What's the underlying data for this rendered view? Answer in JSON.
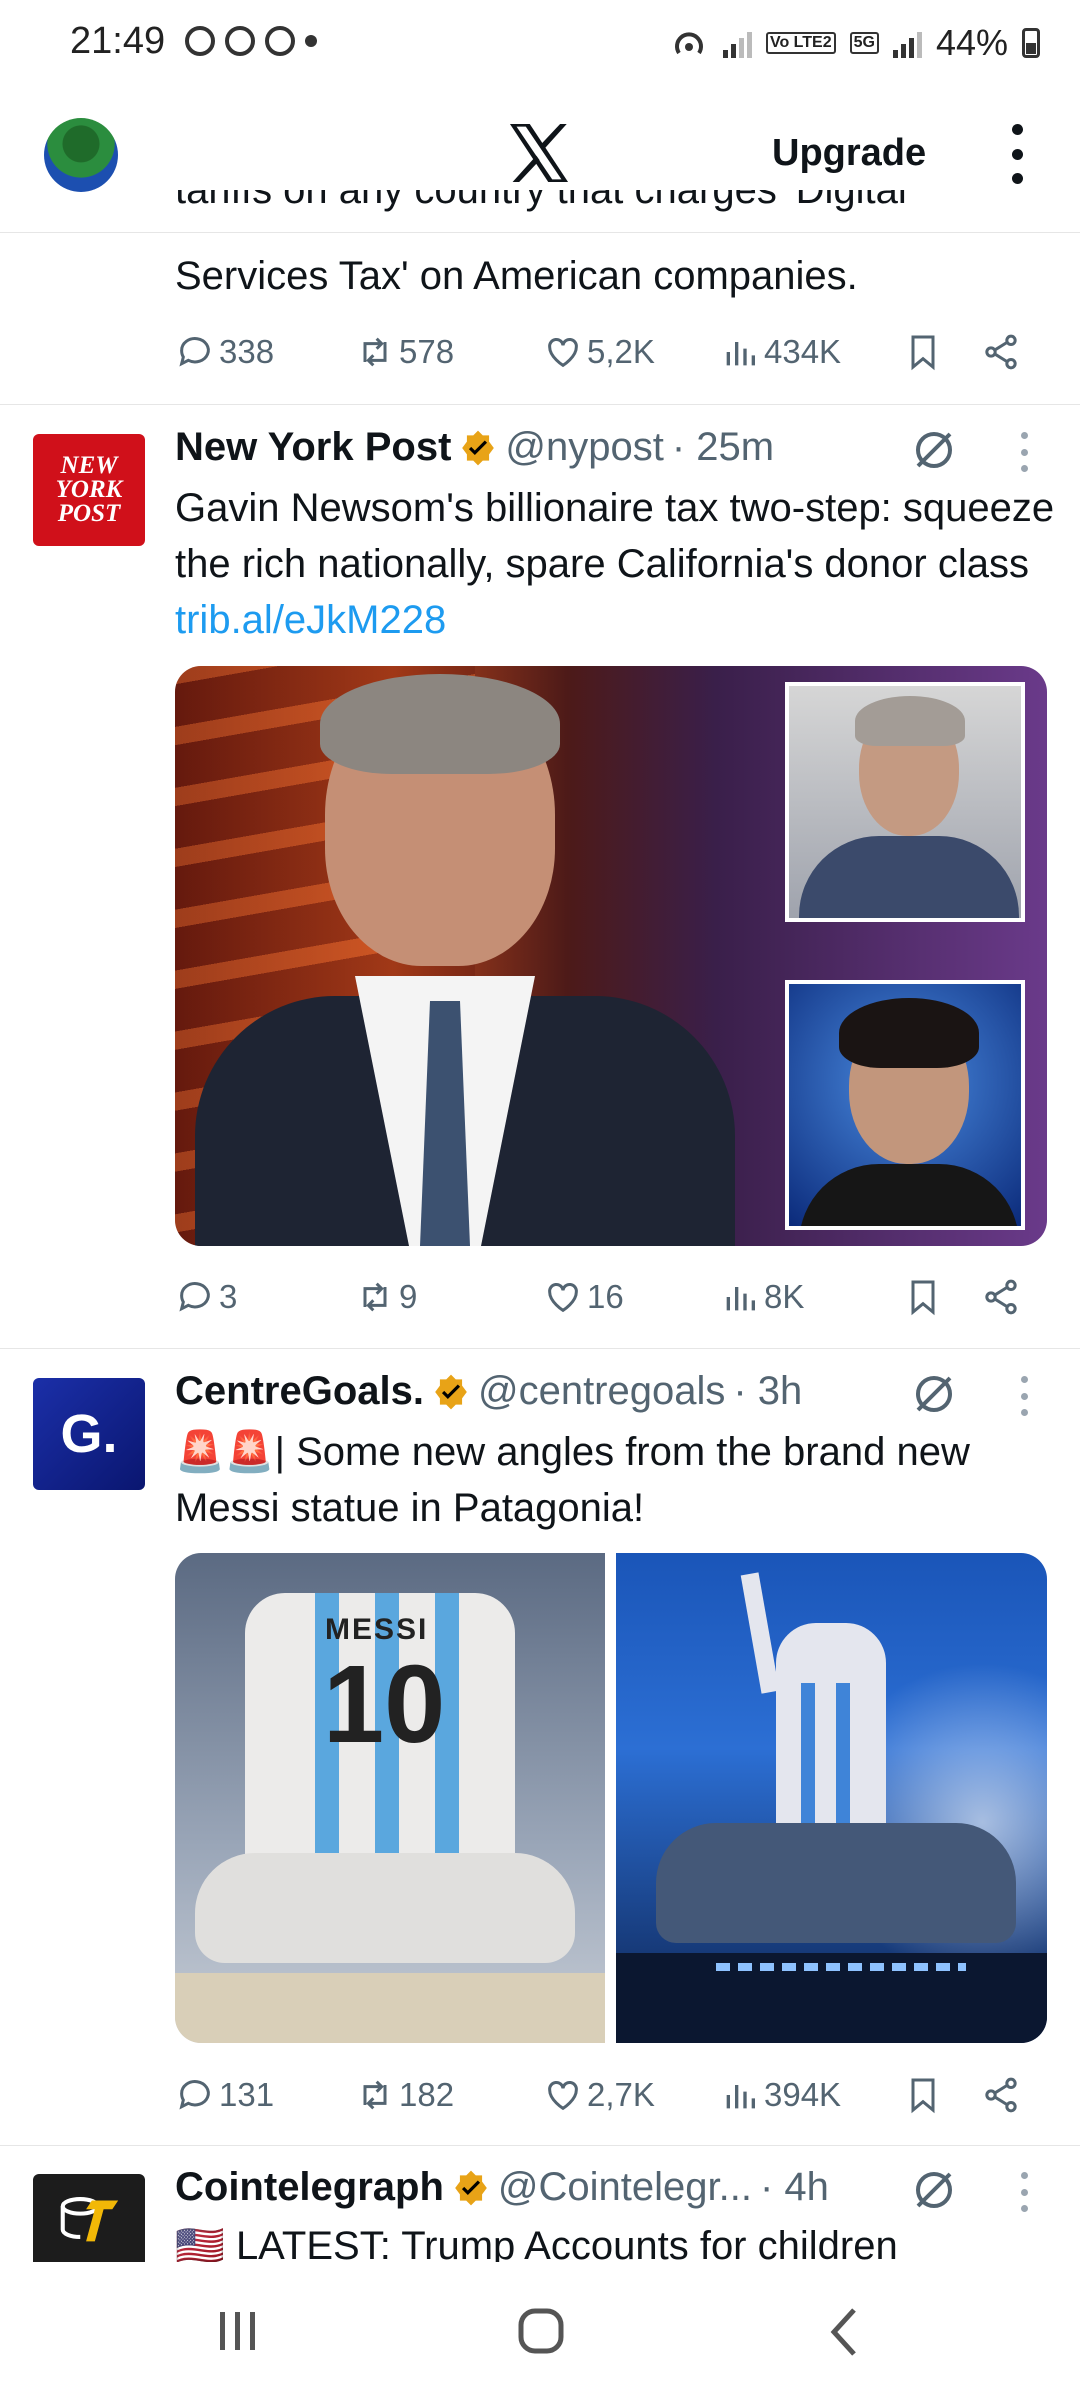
{
  "status_bar": {
    "time": "21:49",
    "network_tag": "Vo LTE2",
    "fiveg": "5G",
    "battery": "44%"
  },
  "header": {
    "upgrade_label": "Upgrade"
  },
  "tweets": [
    {
      "text_partial_top": "tariffs on any country that charges 'Digital",
      "text_line": "Services Tax' on American companies.",
      "replies": "338",
      "reposts": "578",
      "likes": "5,2K",
      "views": "434K"
    },
    {
      "name": "New York Post",
      "handle": "@nypost",
      "time": "· 25m",
      "avatar_text": "NEW YORK POST",
      "text": "Gavin Newsom's billionaire tax two-step: squeeze the rich nationally, spare California's donor class ",
      "link": "trib.al/eJkM228",
      "replies": "3",
      "reposts": "9",
      "likes": "16",
      "views": "8K"
    },
    {
      "name": "CentreGoals.",
      "handle": "@centregoals",
      "time": "· 3h",
      "avatar_text": "G.",
      "emoji": "🚨🚨",
      "text": "| Some new angles from the brand new Messi statue in Patagonia!",
      "jersey_text": "MESSI",
      "jersey_number": "10",
      "replies": "131",
      "reposts": "182",
      "likes": "2,7K",
      "views": "394K"
    },
    {
      "name": "Cointelegraph",
      "handle": "@Cointelegr...",
      "time": "· 4h",
      "flag": "🇺🇸",
      "text": "LATEST: Trump Accounts for children"
    }
  ],
  "colors": {
    "link": "#1d9bf0",
    "verified": "#e8a317",
    "muted": "#536471"
  }
}
